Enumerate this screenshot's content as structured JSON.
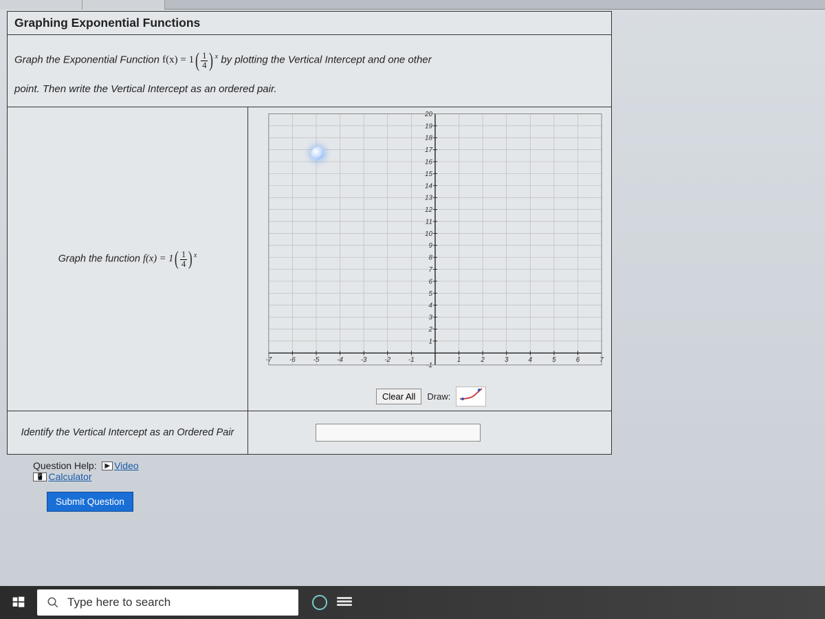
{
  "title": "Graphing Exponential Functions",
  "prompt_pre": "Graph the Exponential Function ",
  "prompt_fx": "f(x) = 1",
  "prompt_frac_num": "1",
  "prompt_frac_den": "4",
  "prompt_exp": "x",
  "prompt_mid": " by plotting the Vertical Intercept and one other",
  "prompt_line2": "point. Then write the Vertical Intercept as an ordered pair.",
  "row1_label_pre": "Graph the function ",
  "row1_fx": "f(x) = 1",
  "row1_frac_num": "1",
  "row1_frac_den": "4",
  "row1_exp": "x",
  "row2_label": "Identify the Vertical Intercept as an Ordered Pair",
  "btn_clear": "Clear All",
  "label_draw": "Draw:",
  "help_label": "Question Help:",
  "help_video": "Video",
  "help_calc": "Calculator",
  "submit": "Submit Question",
  "search_placeholder": "Type here to search",
  "calc_icon": "📱",
  "video_icon": "▶",
  "chart_data": {
    "type": "scatter",
    "title": "",
    "xlabel": "",
    "ylabel": "",
    "x_ticks": [
      -7,
      -6,
      -5,
      -4,
      -3,
      -2,
      -1,
      1,
      2,
      3,
      4,
      5,
      6,
      7
    ],
    "y_ticks": [
      1,
      2,
      3,
      4,
      5,
      6,
      7,
      8,
      9,
      10,
      11,
      12,
      13,
      14,
      15,
      16,
      17,
      18,
      19,
      20
    ],
    "xlim": [
      -7,
      7
    ],
    "ylim": [
      -1,
      20
    ],
    "series": []
  }
}
